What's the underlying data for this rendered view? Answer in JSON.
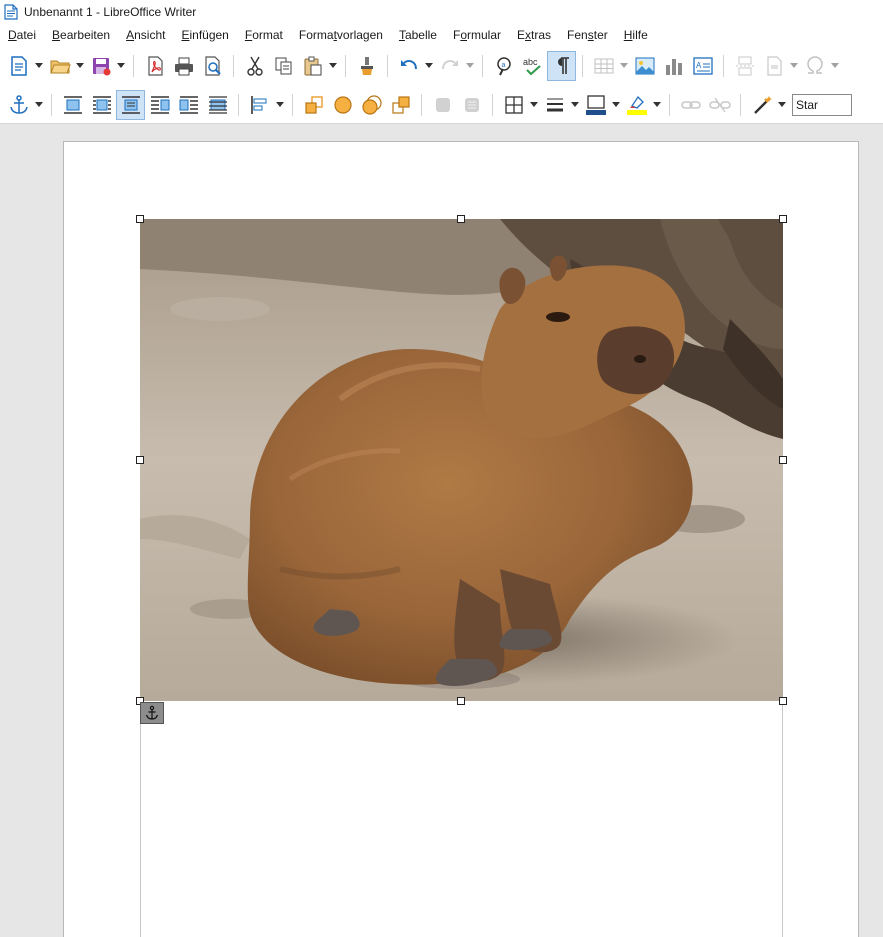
{
  "window": {
    "title": "Unbenannt 1 - LibreOffice Writer"
  },
  "menu": [
    {
      "pre": "",
      "acc": "D",
      "post": "atei"
    },
    {
      "pre": "",
      "acc": "B",
      "post": "earbeiten"
    },
    {
      "pre": "",
      "acc": "A",
      "post": "nsicht"
    },
    {
      "pre": "",
      "acc": "E",
      "post": "infügen"
    },
    {
      "pre": "",
      "acc": "F",
      "post": "ormat"
    },
    {
      "pre": "Forma",
      "acc": "t",
      "post": "vorlagen"
    },
    {
      "pre": "",
      "acc": "T",
      "post": "abelle"
    },
    {
      "pre": "F",
      "acc": "o",
      "post": "rmular"
    },
    {
      "pre": "E",
      "acc": "x",
      "post": "tras"
    },
    {
      "pre": "Fen",
      "acc": "s",
      "post": "ter"
    },
    {
      "pre": "",
      "acc": "H",
      "post": "ilfe"
    }
  ],
  "toolbar2": {
    "style_box_value": "Star"
  },
  "colors": {
    "accent": "#1e6fbf",
    "active_button": "#cfe3f7",
    "font_color_bar": "#1f4e8c",
    "highlight_bar": "#ffff00",
    "page": "#ffffff",
    "workspace": "#e6e6e6"
  },
  "icons": {
    "toolbar1": [
      "new-document-icon",
      "open-folder-icon",
      "save-icon",
      "export-pdf-icon",
      "print-icon",
      "print-preview-icon",
      "cut-icon",
      "copy-icon",
      "paste-icon",
      "clone-formatting-icon",
      "undo-icon",
      "redo-icon",
      "find-replace-icon",
      "spellcheck-icon",
      "formatting-marks-icon",
      "insert-table-icon",
      "insert-image-icon",
      "insert-chart-icon",
      "insert-textbox-icon",
      "page-break-icon",
      "insert-field-icon",
      "special-character-icon"
    ],
    "toolbar2": [
      "anchor-icon",
      "wrap-off-icon",
      "wrap-page-icon",
      "wrap-optimal-icon",
      "wrap-left-icon",
      "wrap-right-icon",
      "wrap-through-icon",
      "align-objects-icon",
      "bring-to-front-icon",
      "forward-one-icon",
      "back-one-icon",
      "send-to-back-icon",
      "to-foreground-icon",
      "to-background-icon",
      "borders-icon",
      "border-style-icon",
      "border-color-icon",
      "area-style-icon",
      "link-frames-icon",
      "unlink-frames-icon",
      "wizard-icon"
    ]
  }
}
